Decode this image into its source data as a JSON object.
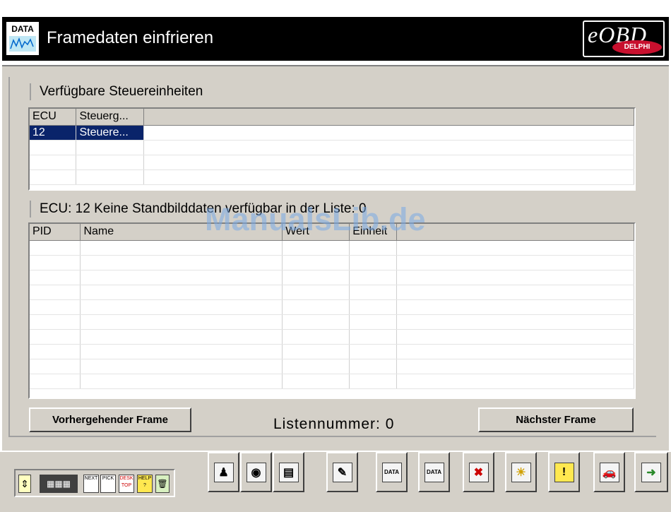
{
  "window": {
    "title": "Framedaten einfrieren",
    "icon_label": "DATA",
    "logo_text": "eOBD",
    "logo_sub": "DELPHI"
  },
  "ecu_section": {
    "title": "Verfügbare Steuereinheiten",
    "columns": [
      "ECU",
      "Steuerg..."
    ],
    "rows": [
      {
        "ecu": "12",
        "name": "Steuere...",
        "selected": true
      }
    ]
  },
  "freeze_section": {
    "title": "ECU: 12  Keine Standbilddaten verfügbar in der Liste: 0",
    "columns": [
      "PID",
      "Name",
      "Wert",
      "Einheit"
    ],
    "rows": []
  },
  "buttons": {
    "previous": "Vorhergehender Frame",
    "next": "Nächster Frame"
  },
  "list_number": "Listennummer: 0",
  "watermark": "ManualsLib.de",
  "toolbar": {
    "left_group": [
      "move-icon",
      "keyboard-icon",
      "next-icon",
      "pick-icon",
      "desktop-icon",
      "help-icon",
      "trash-icon"
    ],
    "left_labels": {
      "next": "NEXT",
      "pick": "PICK",
      "desk": "DESK TOP",
      "help": "HELP ?"
    },
    "tools": [
      {
        "name": "stick-tool-icon",
        "glyph": "♟"
      },
      {
        "name": "eye-icon",
        "glyph": "◉"
      },
      {
        "name": "folder-data-icon",
        "glyph": "▤"
      },
      {
        "name": "pen-tool-icon",
        "glyph": "✎"
      },
      {
        "name": "data-graph-icon",
        "glyph": "DATA"
      },
      {
        "name": "data-table-icon",
        "glyph": "DATA"
      },
      {
        "name": "cancel-x-icon",
        "glyph": "✖"
      },
      {
        "name": "light-icon",
        "glyph": "☀"
      },
      {
        "name": "warning-icon",
        "glyph": "!"
      },
      {
        "name": "car-icon",
        "glyph": "🚗"
      },
      {
        "name": "exit-icon",
        "glyph": "➜"
      }
    ]
  }
}
